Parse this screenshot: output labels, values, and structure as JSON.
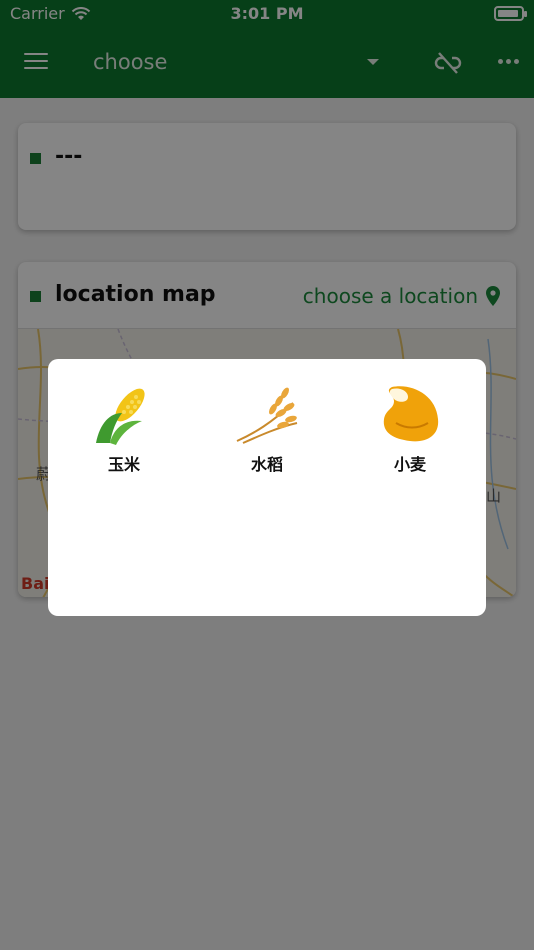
{
  "status_bar": {
    "carrier": "Carrier",
    "time": "3:01 PM"
  },
  "app_bar": {
    "title": "choose"
  },
  "card_top": {
    "title": "---"
  },
  "location_card": {
    "title": "location map",
    "action": "choose a location",
    "map_logo": "Bai",
    "map_labels": [
      "蔚",
      "山"
    ]
  },
  "crop_dialog": {
    "items": [
      {
        "label": "玉米",
        "icon": "corn-icon"
      },
      {
        "label": "水稻",
        "icon": "rice-icon"
      },
      {
        "label": "小麦",
        "icon": "wheat-bean-icon"
      }
    ]
  },
  "colors": {
    "primary": "#0d7a2e",
    "accent": "#1b8a3c"
  }
}
